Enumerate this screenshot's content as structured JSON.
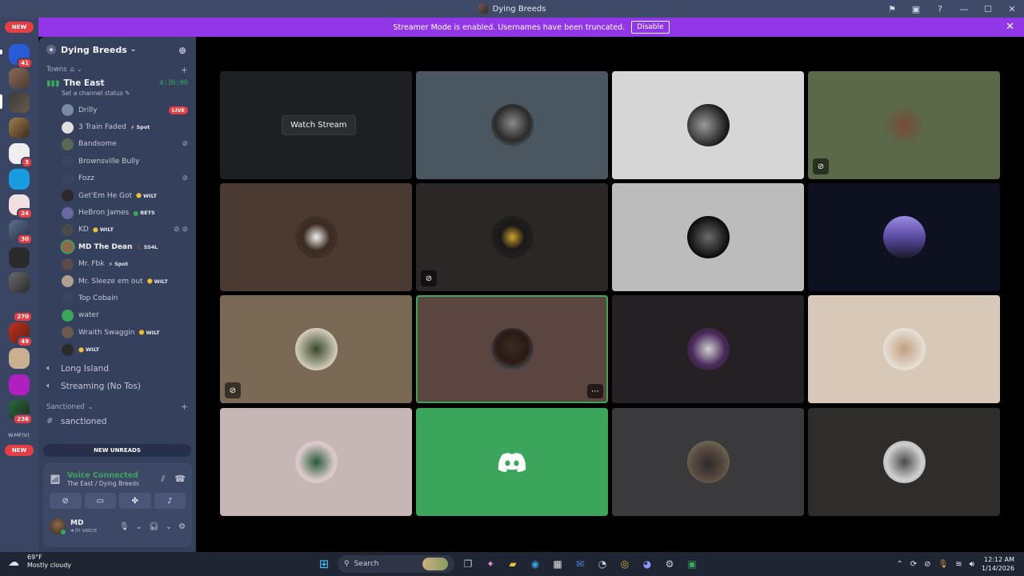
{
  "window": {
    "title": "Dying Breeds"
  },
  "banner": {
    "text": "Streamer Mode is enabled. Usernames have been truncated.",
    "button": "Disable"
  },
  "rail": {
    "new_top": "NEW",
    "new_bottom": "NEW",
    "badges": [
      "41",
      "3",
      "24",
      "30",
      "270",
      "49",
      "236"
    ],
    "wmf_label": "W.MF(V)"
  },
  "server": {
    "name": "Dying Breeds"
  },
  "categories": {
    "towns": "Towns",
    "sanctioned": "Sanctioned"
  },
  "voice_channel": {
    "name": "The East",
    "timer": "4:30:00",
    "status_placeholder": "Set a channel status",
    "live_label": "LIVE",
    "members": [
      {
        "name": "Drilly",
        "tag": "",
        "live": true
      },
      {
        "name": "3 Train Faded",
        "tag": "Spot"
      },
      {
        "name": "Bandsome",
        "tag": ""
      },
      {
        "name": "Brownsville Bully",
        "tag": ""
      },
      {
        "name": "Fozz",
        "tag": ""
      },
      {
        "name": "Get'Em He Got",
        "tag": "WILT"
      },
      {
        "name": "HeBron James",
        "tag": "BETS"
      },
      {
        "name": "KD",
        "tag": "WILT"
      },
      {
        "name": "MD The Dean",
        "tag": "SS4L"
      },
      {
        "name": "Mr. Fbk",
        "tag": "Spot"
      },
      {
        "name": "Mr. Sleeze em out",
        "tag": "WILT"
      },
      {
        "name": "Top Cobain",
        "tag": ""
      },
      {
        "name": "water",
        "tag": ""
      },
      {
        "name": "Wraith Swaggin",
        "tag": "WILT"
      },
      {
        "name": "",
        "tag": "WILT"
      }
    ]
  },
  "channels": {
    "long_island": "Long Island",
    "streaming": "Streaming (No Tos)",
    "sanctioned": "sanctioned"
  },
  "new_unreads": "NEW UNREADS",
  "voice_panel": {
    "status": "Voice Connected",
    "location": "The East / Dying Breeds",
    "user_name": "MD",
    "user_status": "In voice"
  },
  "stage": {
    "watch_stream": "Watch Stream"
  },
  "taskbar": {
    "temp": "69°F",
    "weather": "Mostly cloudy",
    "search": "Search",
    "time": "12:12 AM",
    "date": "1/14/2026"
  }
}
